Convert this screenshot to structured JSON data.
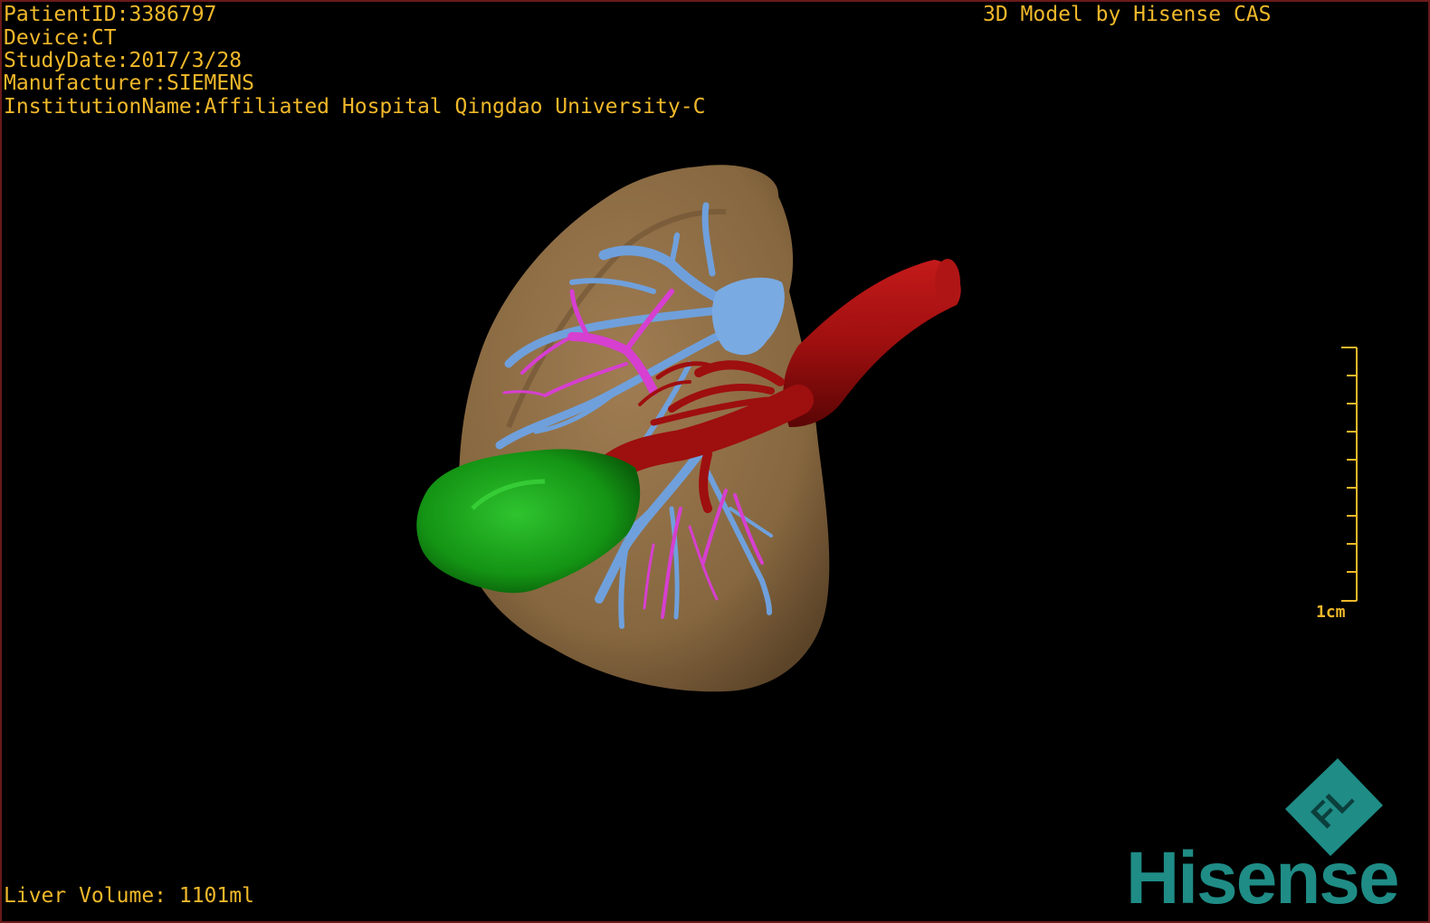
{
  "header": {
    "patient_id": "PatientID:3386797",
    "device": "Device:CT",
    "study_date": "StudyDate:2017/3/28",
    "manufacturer": "Manufacturer:SIEMENS",
    "institution": "InstitutionName:Affiliated Hospital Qingdao University-C"
  },
  "model_credit": "3D Model by Hisense CAS",
  "footer": {
    "liver_volume": "Liver Volume: 1101ml"
  },
  "scale_bar": {
    "label": "1cm"
  },
  "brand": {
    "wordmark": "Hisense",
    "emblem_text": "FL"
  },
  "colors": {
    "overlay_text": "#f0b82a",
    "liver": "#8a6a44",
    "hepatic_vein": "#6fa0dc",
    "portal_vein": "#d63fd0",
    "artery": "#9e0f0f",
    "gallbladder": "#1a9a1a",
    "brand": "#1f8c86",
    "frame": "#6b1a1a"
  },
  "structures": [
    "liver",
    "hepatic veins",
    "portal vein",
    "aorta and arteries",
    "gallbladder"
  ]
}
